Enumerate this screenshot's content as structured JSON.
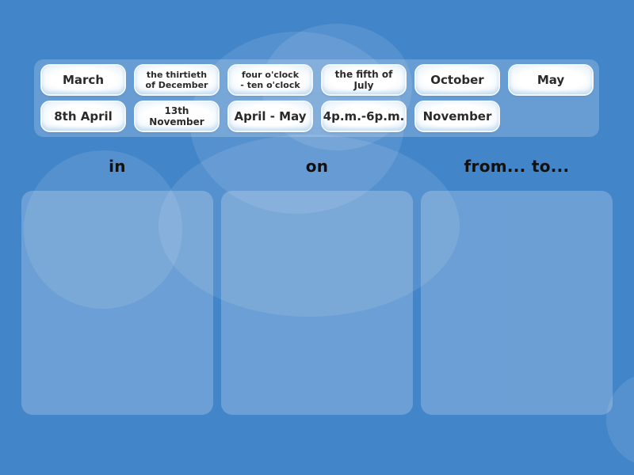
{
  "tray": {
    "cards": [
      {
        "label": "March",
        "size": "big"
      },
      {
        "label": "the thirtieth\nof December",
        "size": "small"
      },
      {
        "label": "four o'clock\n- ten o'clock",
        "size": "small"
      },
      {
        "label": "the fifth of July",
        "size": "mid"
      },
      {
        "label": "October",
        "size": "big"
      },
      {
        "label": "May",
        "size": "big"
      },
      {
        "label": "8th April",
        "size": "big"
      },
      {
        "label": "13th November",
        "size": "mid"
      },
      {
        "label": "April - May",
        "size": "big"
      },
      {
        "label": "4p.m.-6p.m.",
        "size": "big"
      },
      {
        "label": "November",
        "size": "big"
      }
    ]
  },
  "columns": [
    {
      "title": "in"
    },
    {
      "title": "on"
    },
    {
      "title": "from... to..."
    }
  ],
  "colors": {
    "background": "#4285c9",
    "card_text": "#2a2a2a",
    "heading_text": "#111111"
  }
}
